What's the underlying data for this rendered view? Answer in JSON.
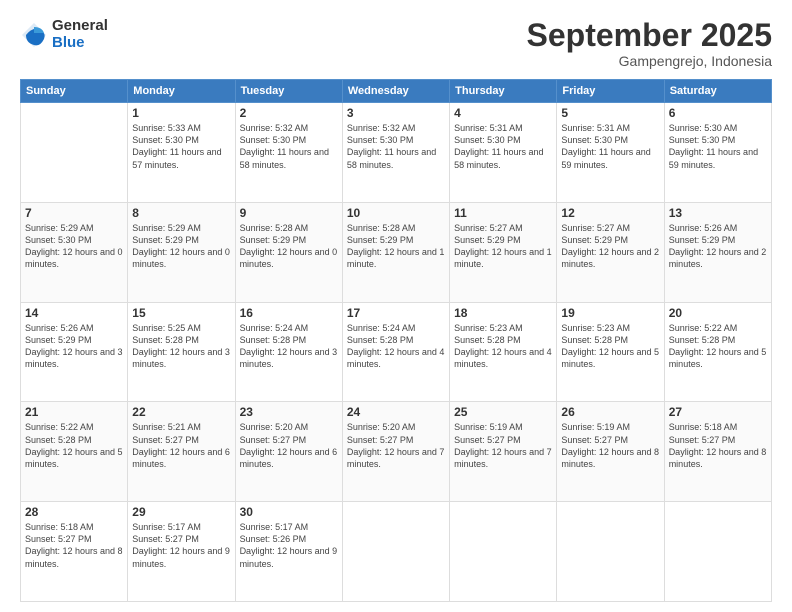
{
  "logo": {
    "general": "General",
    "blue": "Blue"
  },
  "header": {
    "month": "September 2025",
    "location": "Gampengrejo, Indonesia"
  },
  "days_of_week": [
    "Sunday",
    "Monday",
    "Tuesday",
    "Wednesday",
    "Thursday",
    "Friday",
    "Saturday"
  ],
  "weeks": [
    [
      null,
      {
        "day": 1,
        "sunrise": "5:33 AM",
        "sunset": "5:30 PM",
        "daylight": "11 hours and 57 minutes."
      },
      {
        "day": 2,
        "sunrise": "5:32 AM",
        "sunset": "5:30 PM",
        "daylight": "11 hours and 58 minutes."
      },
      {
        "day": 3,
        "sunrise": "5:32 AM",
        "sunset": "5:30 PM",
        "daylight": "11 hours and 58 minutes."
      },
      {
        "day": 4,
        "sunrise": "5:31 AM",
        "sunset": "5:30 PM",
        "daylight": "11 hours and 58 minutes."
      },
      {
        "day": 5,
        "sunrise": "5:31 AM",
        "sunset": "5:30 PM",
        "daylight": "11 hours and 59 minutes."
      },
      {
        "day": 6,
        "sunrise": "5:30 AM",
        "sunset": "5:30 PM",
        "daylight": "11 hours and 59 minutes."
      }
    ],
    [
      {
        "day": 7,
        "sunrise": "5:29 AM",
        "sunset": "5:30 PM",
        "daylight": "12 hours and 0 minutes."
      },
      {
        "day": 8,
        "sunrise": "5:29 AM",
        "sunset": "5:29 PM",
        "daylight": "12 hours and 0 minutes."
      },
      {
        "day": 9,
        "sunrise": "5:28 AM",
        "sunset": "5:29 PM",
        "daylight": "12 hours and 0 minutes."
      },
      {
        "day": 10,
        "sunrise": "5:28 AM",
        "sunset": "5:29 PM",
        "daylight": "12 hours and 1 minute."
      },
      {
        "day": 11,
        "sunrise": "5:27 AM",
        "sunset": "5:29 PM",
        "daylight": "12 hours and 1 minute."
      },
      {
        "day": 12,
        "sunrise": "5:27 AM",
        "sunset": "5:29 PM",
        "daylight": "12 hours and 2 minutes."
      },
      {
        "day": 13,
        "sunrise": "5:26 AM",
        "sunset": "5:29 PM",
        "daylight": "12 hours and 2 minutes."
      }
    ],
    [
      {
        "day": 14,
        "sunrise": "5:26 AM",
        "sunset": "5:29 PM",
        "daylight": "12 hours and 3 minutes."
      },
      {
        "day": 15,
        "sunrise": "5:25 AM",
        "sunset": "5:28 PM",
        "daylight": "12 hours and 3 minutes."
      },
      {
        "day": 16,
        "sunrise": "5:24 AM",
        "sunset": "5:28 PM",
        "daylight": "12 hours and 3 minutes."
      },
      {
        "day": 17,
        "sunrise": "5:24 AM",
        "sunset": "5:28 PM",
        "daylight": "12 hours and 4 minutes."
      },
      {
        "day": 18,
        "sunrise": "5:23 AM",
        "sunset": "5:28 PM",
        "daylight": "12 hours and 4 minutes."
      },
      {
        "day": 19,
        "sunrise": "5:23 AM",
        "sunset": "5:28 PM",
        "daylight": "12 hours and 5 minutes."
      },
      {
        "day": 20,
        "sunrise": "5:22 AM",
        "sunset": "5:28 PM",
        "daylight": "12 hours and 5 minutes."
      }
    ],
    [
      {
        "day": 21,
        "sunrise": "5:22 AM",
        "sunset": "5:28 PM",
        "daylight": "12 hours and 5 minutes."
      },
      {
        "day": 22,
        "sunrise": "5:21 AM",
        "sunset": "5:27 PM",
        "daylight": "12 hours and 6 minutes."
      },
      {
        "day": 23,
        "sunrise": "5:20 AM",
        "sunset": "5:27 PM",
        "daylight": "12 hours and 6 minutes."
      },
      {
        "day": 24,
        "sunrise": "5:20 AM",
        "sunset": "5:27 PM",
        "daylight": "12 hours and 7 minutes."
      },
      {
        "day": 25,
        "sunrise": "5:19 AM",
        "sunset": "5:27 PM",
        "daylight": "12 hours and 7 minutes."
      },
      {
        "day": 26,
        "sunrise": "5:19 AM",
        "sunset": "5:27 PM",
        "daylight": "12 hours and 8 minutes."
      },
      {
        "day": 27,
        "sunrise": "5:18 AM",
        "sunset": "5:27 PM",
        "daylight": "12 hours and 8 minutes."
      }
    ],
    [
      {
        "day": 28,
        "sunrise": "5:18 AM",
        "sunset": "5:27 PM",
        "daylight": "12 hours and 8 minutes."
      },
      {
        "day": 29,
        "sunrise": "5:17 AM",
        "sunset": "5:27 PM",
        "daylight": "12 hours and 9 minutes."
      },
      {
        "day": 30,
        "sunrise": "5:17 AM",
        "sunset": "5:26 PM",
        "daylight": "12 hours and 9 minutes."
      },
      null,
      null,
      null,
      null
    ]
  ]
}
